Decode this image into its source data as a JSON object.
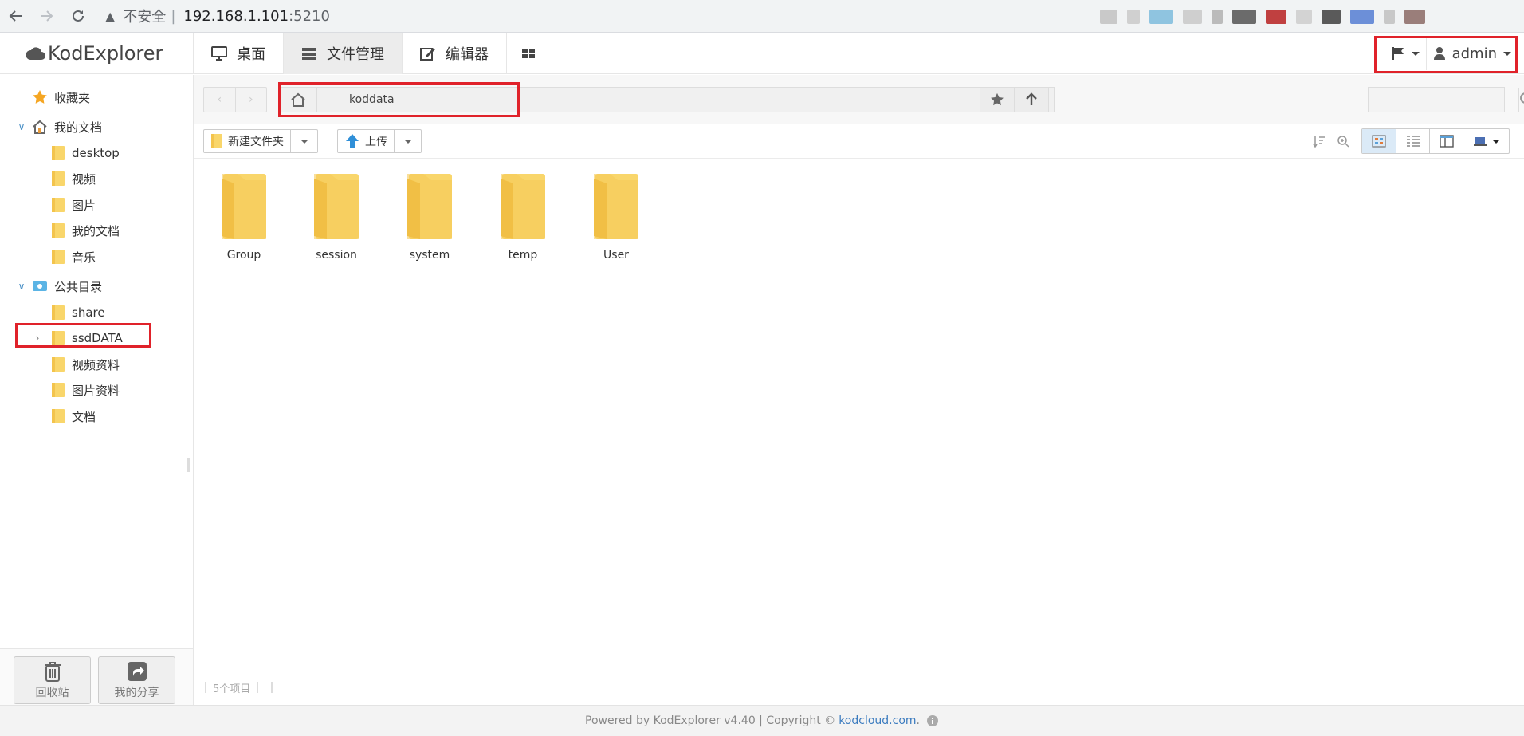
{
  "browser": {
    "security_label": "不安全",
    "separator": "|",
    "url_host": "192.168.1.101",
    "url_port": ":5210"
  },
  "app": {
    "logo_text": "KodExplorer",
    "nav": [
      {
        "label": "桌面",
        "icon": "desktop-icon"
      },
      {
        "label": "文件管理",
        "icon": "file-manager-icon"
      },
      {
        "label": "编辑器",
        "icon": "editor-icon"
      }
    ],
    "user": "admin"
  },
  "sidebar": {
    "favorites": "收藏夹",
    "my_docs": {
      "label": "我的文档",
      "children": [
        "desktop",
        "视频",
        "图片",
        "我的文档",
        "音乐"
      ]
    },
    "public": {
      "label": "公共目录",
      "children": [
        "share",
        "ssdDATA",
        "视频资料",
        "图片资料",
        "文档"
      ]
    },
    "recycle_label": "回收站",
    "share_label": "我的分享"
  },
  "pathbar": {
    "current_folder": "koddata",
    "search_placeholder": ""
  },
  "toolbar": {
    "new_folder_label": "新建文件夹",
    "upload_label": "上传"
  },
  "files": [
    "Group",
    "session",
    "system",
    "temp",
    "User"
  ],
  "status": {
    "item_count": "5个项目"
  },
  "footer": {
    "prefix": "Powered by KodExplorer v4.40 | Copyright ©",
    "link": "kodcloud.com",
    "suffix": "."
  },
  "colors": {
    "highlight_red": "#e0222a",
    "folder_yellow": "#f9d66b",
    "link_blue": "#3b7bbf"
  }
}
